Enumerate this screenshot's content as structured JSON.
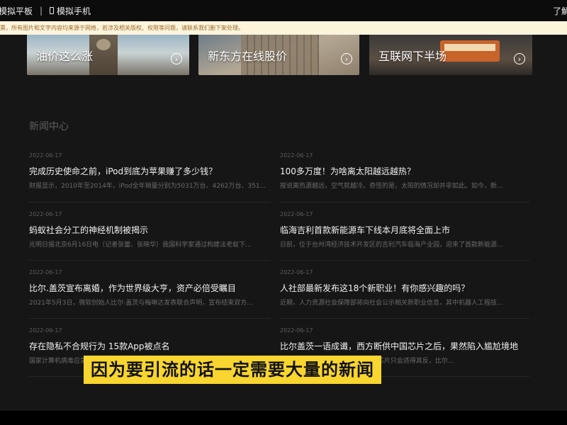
{
  "topbar": {
    "left_label": "模拟平板",
    "separator": "|",
    "phone_label": "模拟手机",
    "right_label": "了解"
  },
  "notice": {
    "text": "票，所有图片和文字内容均来源于网络，若涉及相关版权、权限等问题，请联系我们删下架处理。"
  },
  "cards": [
    {
      "label": "油价这么涨",
      "icon": "chevron-right-circle-icon"
    },
    {
      "label": "新东方在线股价",
      "icon": "chevron-right-circle-icon"
    },
    {
      "label": "互联网下半场",
      "icon": "chevron-right-circle-icon"
    }
  ],
  "news_center": {
    "title": "新闻中心",
    "items": [
      {
        "date": "2022-06-17",
        "title": "完成历史使命之前，iPod到底为苹果赚了多少钱？",
        "summary": "财报显示，2010年至2014年，iPod全年销量分别为5031万台、4262万台、351..."
      },
      {
        "date": "2022-06-17",
        "title": "100多万度！为啥离太阳越远越热？",
        "summary": "按说离热源越远，空气就越冷。奇怪的是，太阳的情况却并非如此。如今，新..."
      },
      {
        "date": "2022-06-17",
        "title": "蚂蚁社会分工的神经机制被揭示",
        "summary": "光明日报北京6月16日电（记者张蕾、张晓华）我国科学家通过构建法老蚁下..."
      },
      {
        "date": "2022-06-17",
        "title": "临海吉利首款新能源车下线本月底将全面上市",
        "summary": "日前，位于台州湾经济技术开发区的吉利汽车临海产业园，迎来了首款新能源..."
      },
      {
        "date": "2022-06-17",
        "title": "比尔.盖茨宣布离婚，作为世界级大亨，资产必倍受瞩目",
        "summary": "2021年5月3日，微软创始人比尔·盖茨与梅琳达发表联合声明，宣布结束双方..."
      },
      {
        "date": "2022-06-17",
        "title": "人社部最新发布这18个新职业！有你感兴趣的吗？",
        "summary": "近期，人力资源社会保障部将向社会公示相关新职业信息，其中机器人工程技..."
      },
      {
        "date": "2022-06-17",
        "title": "存在隐私不合规行为 15款App被点名",
        "summary": "国家计算机病毒应急处理中心近期在“净网2022”专项行动中..."
      },
      {
        "date": "2022-06-17",
        "title": "比尔盖茨一语成谶，西方断供中国芯片之后，果然陷入尴尬境地",
        "summary": "比尔·盖茨曾表示，限制向中国出口芯片只会适得其反，比尔..."
      }
    ]
  },
  "subtitle": {
    "text": "因为要引流的话一定需要大量的新闻"
  }
}
